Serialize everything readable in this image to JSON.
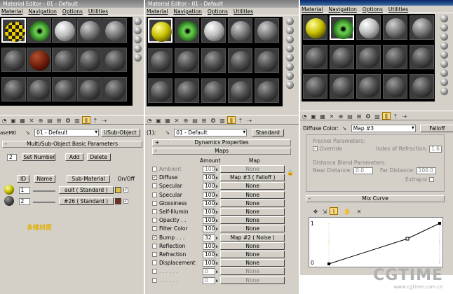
{
  "panel1": {
    "title": "Material Editor - 01 - Default",
    "menu": [
      "Material",
      "Navigation",
      "Options",
      "Utilities"
    ],
    "name_field": "01 - Default",
    "type_button": "i/Sub-Object",
    "left_cut_label": "aseMtl",
    "rollout_title": "Multi/Sub-Object Basic Parameters",
    "count": "2",
    "set_number": "Set Number",
    "add": "Add",
    "delete": "Delete",
    "headers": {
      "id": "ID",
      "name": "Name",
      "submat": "Sub-Material",
      "onoff": "On/Off"
    },
    "rows": [
      {
        "id": "1",
        "submat": "ault  ( Standard )",
        "color": "#e0c040"
      },
      {
        "id": "2",
        "submat": "#26   ( Standard )",
        "color": "#703020"
      }
    ],
    "caption": "多维材质"
  },
  "panel2": {
    "title": "Material Editor - 01 - Default",
    "menu": [
      "Material",
      "Navigation",
      "Options",
      "Utilities"
    ],
    "name_prefix": "(1):",
    "name_field": "01 - Default",
    "type_button": "Standard",
    "dynamics": "Dynamics Properties",
    "maps_title": "Maps",
    "col_amount": "Amount",
    "col_map": "Map",
    "maps": [
      {
        "label": "Ambient",
        "amount": "100",
        "map": "None",
        "checked": false,
        "dim": true
      },
      {
        "label": "Diffuse",
        "amount": "100",
        "map": "Map #3  ( Falloff )",
        "checked": true,
        "dim": false
      },
      {
        "label": "Specular",
        "amount": "100",
        "map": "None",
        "checked": false,
        "dim": false
      },
      {
        "label": "Specular",
        "amount": "100",
        "map": "None",
        "checked": false,
        "dim": false
      },
      {
        "label": "Glossiness",
        "amount": "100",
        "map": "None",
        "checked": false,
        "dim": false
      },
      {
        "label": "Self-Illumin",
        "amount": "100",
        "map": "None",
        "checked": false,
        "dim": false
      },
      {
        "label": "Opacity . .",
        "amount": "100",
        "map": "None",
        "checked": false,
        "dim": false
      },
      {
        "label": "Filter Color",
        "amount": "100",
        "map": "None",
        "checked": false,
        "dim": false
      },
      {
        "label": "Bump . . .",
        "amount": "32",
        "map": "Map #2  ( Noise )",
        "checked": true,
        "dim": false
      },
      {
        "label": "Reflection",
        "amount": "100",
        "map": "None",
        "checked": false,
        "dim": false
      },
      {
        "label": "Refraction",
        "amount": "100",
        "map": "None",
        "checked": false,
        "dim": false
      },
      {
        "label": "Displacement",
        "amount": "100",
        "map": "None",
        "checked": false,
        "dim": false
      },
      {
        "label": ". . . . . .",
        "amount": "0",
        "map": "None",
        "checked": false,
        "dim": true
      },
      {
        "label": ". . . . . .",
        "amount": "0",
        "map": "None",
        "checked": false,
        "dim": true
      }
    ]
  },
  "panel3": {
    "title": "",
    "menu": [
      "Material",
      "Navigation",
      "Options",
      "Utilities"
    ],
    "label": "Diffuse Color:",
    "name_field": "Map #3",
    "type_button": "Falloff",
    "fresnel": "Fresnel Parameters:",
    "override": "Override",
    "ior_label": "Index of Refraction:",
    "ior_value": "1.6",
    "distance": "Distance Blend Parameters:",
    "near_label": "Near Distance:",
    "near_value": "0.0",
    "far_label": "Far Distance:",
    "far_value": "100.0",
    "extrapol": "Extrapol",
    "mix_curve": "Mix Curve",
    "curve_y_top": "1",
    "curve_y_bottom": "0"
  },
  "watermark": {
    "text": "CGTIME",
    "url": "www.cgtime.com.cn"
  }
}
